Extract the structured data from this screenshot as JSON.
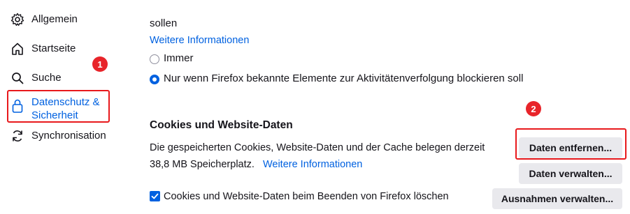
{
  "sidebar": {
    "items": [
      {
        "label": "Allgemein",
        "icon": "gear-icon"
      },
      {
        "label": "Startseite",
        "icon": "home-icon"
      },
      {
        "label": "Suche",
        "icon": "search-icon"
      },
      {
        "label_line1": "Datenschutz &",
        "label_line2": "Sicherheit",
        "icon": "lock-icon",
        "active": true
      },
      {
        "label": "Synchronisation",
        "icon": "sync-icon"
      }
    ]
  },
  "content": {
    "clipped_text": "sollen",
    "more_info_link": "Weitere Informationen",
    "radio_always": "Immer",
    "radio_only_when": "Nur wenn Firefox bekannte Elemente zur Aktivitätenverfolgung blockieren soll",
    "cookies_heading": "Cookies und Website-Daten",
    "cookies_desc_line1": "Die gespeicherten Cookies, Website-Daten und der Cache belegen derzeit",
    "cookies_desc_line2": "38,8 MB Speicherplatz.",
    "cookies_more_info_link": "Weitere Informationen",
    "checkbox_label": "Cookies und Website-Daten beim Beenden von Firefox löschen",
    "btn_remove_data": "Daten entfernen...",
    "btn_manage_data": "Daten verwalten...",
    "btn_manage_exceptions": "Ausnahmen verwalten..."
  },
  "annotations": {
    "badge_1": "1",
    "badge_2": "2"
  },
  "colors": {
    "accent": "#0061e0",
    "annotation_red": "#e8191c",
    "button_bg": "#e9e9ed"
  }
}
